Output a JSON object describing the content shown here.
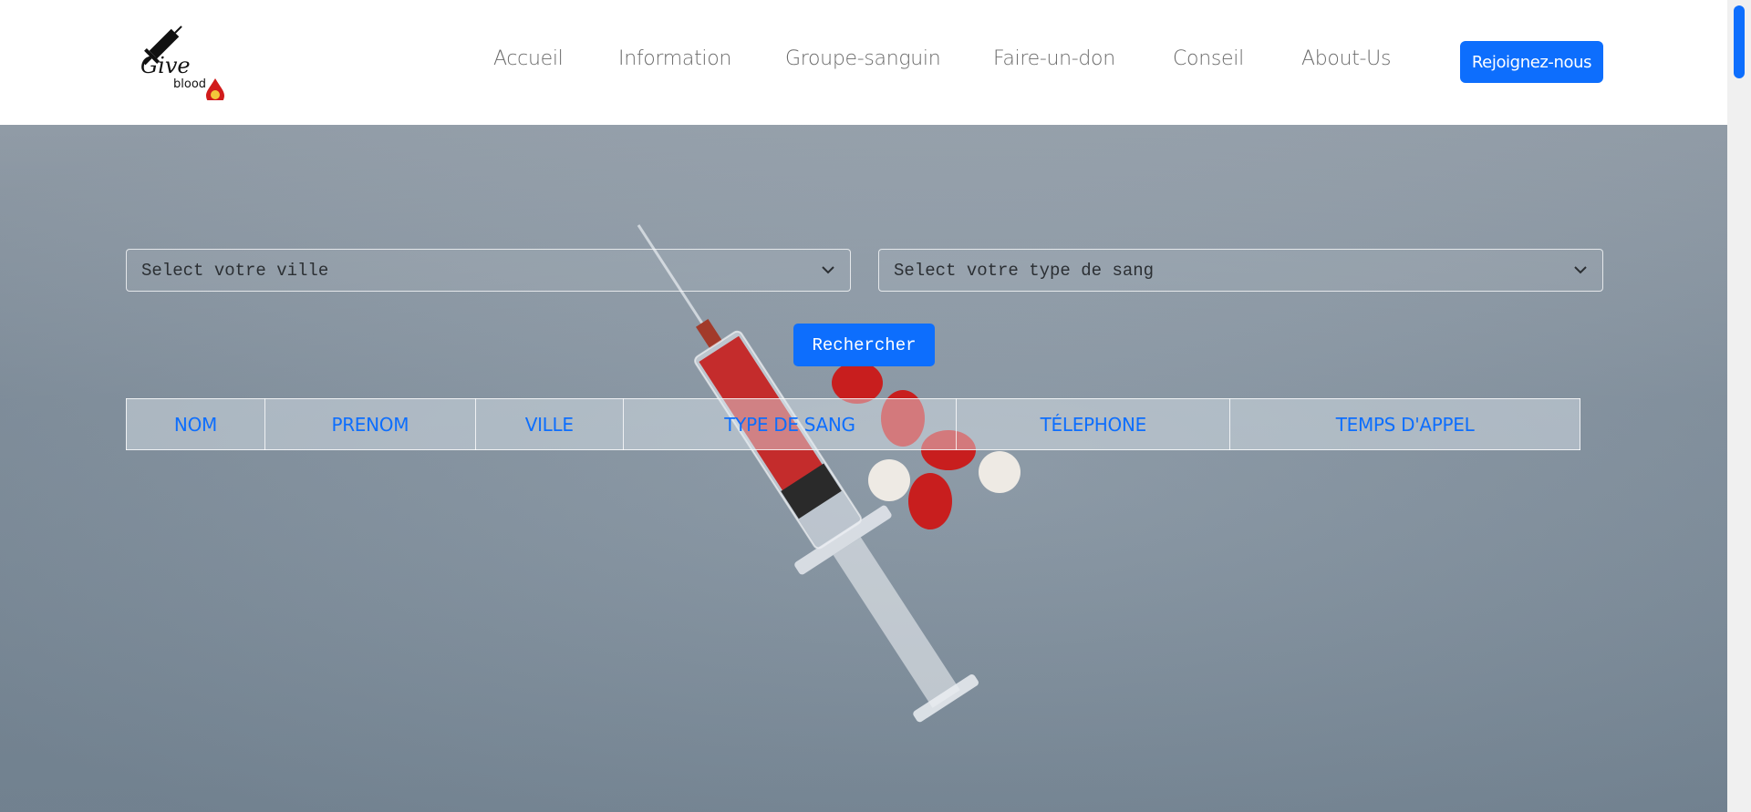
{
  "logo": {
    "text_main": "Give",
    "text_sub": "blood",
    "icon": "syringe-blood-drop-icon"
  },
  "nav": {
    "items": [
      {
        "label": "Accueil"
      },
      {
        "label": "Information"
      },
      {
        "label": "Groupe-sanguin"
      },
      {
        "label": "Faire-un-don"
      },
      {
        "label": "Conseil"
      },
      {
        "label": "About-Us"
      }
    ],
    "cta_label": "Rejoignez-nous"
  },
  "search": {
    "city_select": "Select votre ville",
    "blood_select": "Select votre type de sang",
    "button_label": "Rechercher"
  },
  "table": {
    "headers": [
      "NOM",
      "PRENOM",
      "VILLE",
      "TYPE DE SANG",
      "TÉLEPHONE",
      "TEMPS D'APPEL"
    ]
  },
  "colors": {
    "accent": "#0d6efd",
    "nav_text": "#6b6b6b",
    "hero_bg": "#8896a3",
    "blood": "#c81e1e"
  }
}
